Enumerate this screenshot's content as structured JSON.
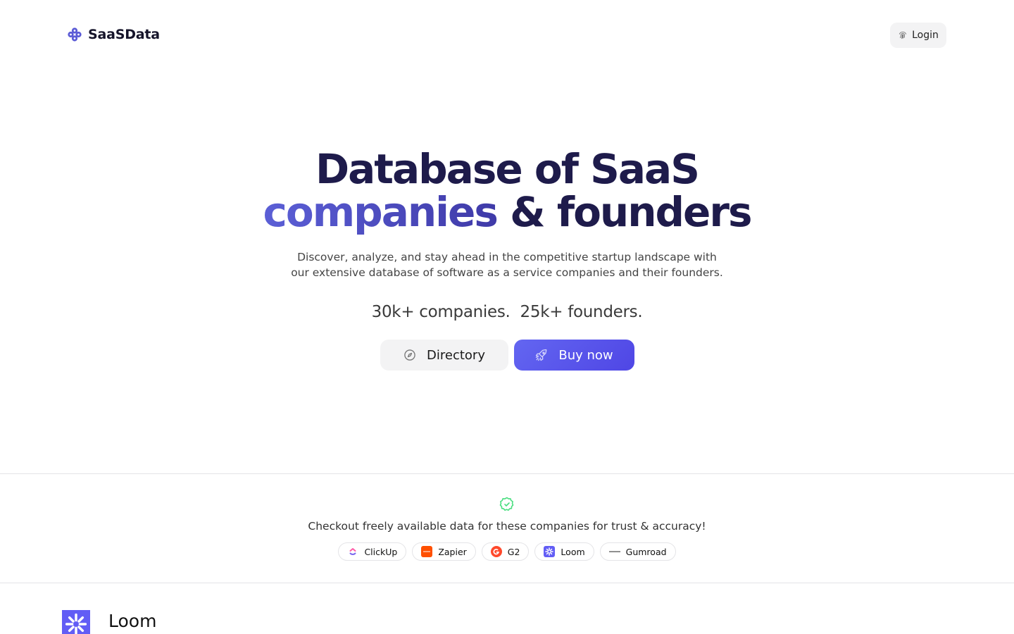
{
  "nav": {
    "brand_name": "SaaSData",
    "brand_icon": "clover-logo-icon",
    "login_label": "Login",
    "login_icon": "fingerprint-icon"
  },
  "hero": {
    "title_line1": "Database of SaaS",
    "title_line2_accent": "companies",
    "title_line2_rest": " & founders",
    "subtitle_line1": "Discover, analyze, and stay ahead in the competitive startup landscape with",
    "subtitle_line2": "our extensive database of software as a service companies and their founders.",
    "stat_companies": "30k+ companies.",
    "stat_founders": "25k+ founders.",
    "directory_label": "Directory",
    "directory_icon": "compass-icon",
    "buy_label": "Buy now",
    "buy_icon": "rocket-icon"
  },
  "trust": {
    "icon": "verified-badge-icon",
    "text": "Checkout freely available data for these companies for trust & accuracy!",
    "companies": [
      {
        "name": "ClickUp",
        "icon": "clickup-logo-icon",
        "color": "#7b68ee"
      },
      {
        "name": "Zapier",
        "icon": "zapier-logo-icon",
        "color": "#ff4f00"
      },
      {
        "name": "G2",
        "icon": "g2-logo-icon",
        "color": "#ff492c"
      },
      {
        "name": "Loom",
        "icon": "loom-logo-icon",
        "color": "#625df5"
      },
      {
        "name": "Gumroad",
        "icon": "gumroad-logo-icon",
        "color": "#222222"
      }
    ]
  },
  "featured": {
    "name": "Loom",
    "icon": "loom-logo-icon",
    "color": "#625df5"
  },
  "colors": {
    "accent": "#4f46e5",
    "title_dark": "#1e1b4b",
    "verified_green": "#4ade80"
  }
}
